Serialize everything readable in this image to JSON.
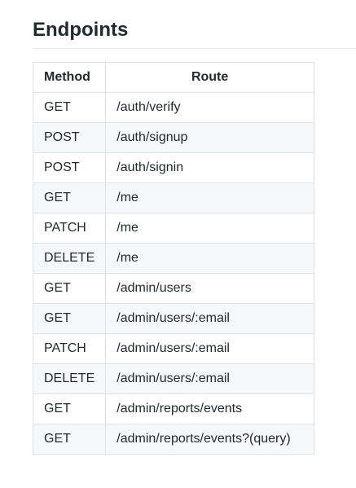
{
  "section": {
    "title": "Endpoints"
  },
  "table": {
    "headers": {
      "method": "Method",
      "route": "Route"
    },
    "rows": [
      {
        "method": "GET",
        "route": "/auth/verify"
      },
      {
        "method": "POST",
        "route": "/auth/signup"
      },
      {
        "method": "POST",
        "route": "/auth/signin"
      },
      {
        "method": "GET",
        "route": "/me"
      },
      {
        "method": "PATCH",
        "route": "/me"
      },
      {
        "method": "DELETE",
        "route": "/me"
      },
      {
        "method": "GET",
        "route": "/admin/users"
      },
      {
        "method": "GET",
        "route": "/admin/users/:email"
      },
      {
        "method": "PATCH",
        "route": "/admin/users/:email"
      },
      {
        "method": "DELETE",
        "route": "/admin/users/:email"
      },
      {
        "method": "GET",
        "route": "/admin/reports/events"
      },
      {
        "method": "GET",
        "route": "/admin/reports/events?(query)"
      }
    ]
  }
}
